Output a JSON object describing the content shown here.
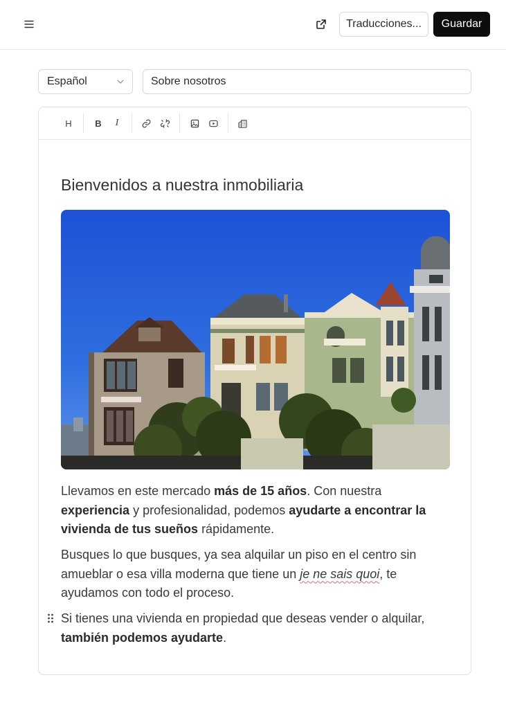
{
  "header": {
    "translations_label": "Traducciones...",
    "save_label": "Guardar"
  },
  "form": {
    "language": "Español",
    "title_value": "Sobre nosotros"
  },
  "toolbar": {
    "heading_label": "H",
    "bold_label": "B",
    "italic_label": "I"
  },
  "content": {
    "heading": "Bienvenidos a nuestra inmobiliaria",
    "p1": {
      "t1": "Llevamos en este mercado ",
      "b1": "más de 15 años",
      "t2": ". Con nuestra ",
      "b2": "experiencia",
      "t3": " y profesionalidad, podemos ",
      "b3": "ayudarte a encontrar la vivienda de tus sueños",
      "t4": " rápidamente."
    },
    "p2": {
      "t1": "Busques lo que busques, ya sea alquilar un piso en el centro sin amueblar o esa villa moderna que tiene un ",
      "i1": "je ne sais quoi",
      "t2": ", te ayudamos con todo el proceso."
    },
    "p3": {
      "t1": "Si tienes una vivienda en propiedad que deseas vender o alquilar, ",
      "b1": "también podemos ayudarte",
      "t2": "."
    }
  },
  "colors": {
    "primary_button": "#0d0d0d",
    "border": "#d8d8d8",
    "sky": "#2f6fe0"
  },
  "icons": [
    "menu-icon",
    "external-link-icon",
    "chevron-down-icon",
    "link-icon",
    "unlink-icon",
    "image-icon",
    "video-icon",
    "building-icon",
    "drag-handle-icon"
  ]
}
